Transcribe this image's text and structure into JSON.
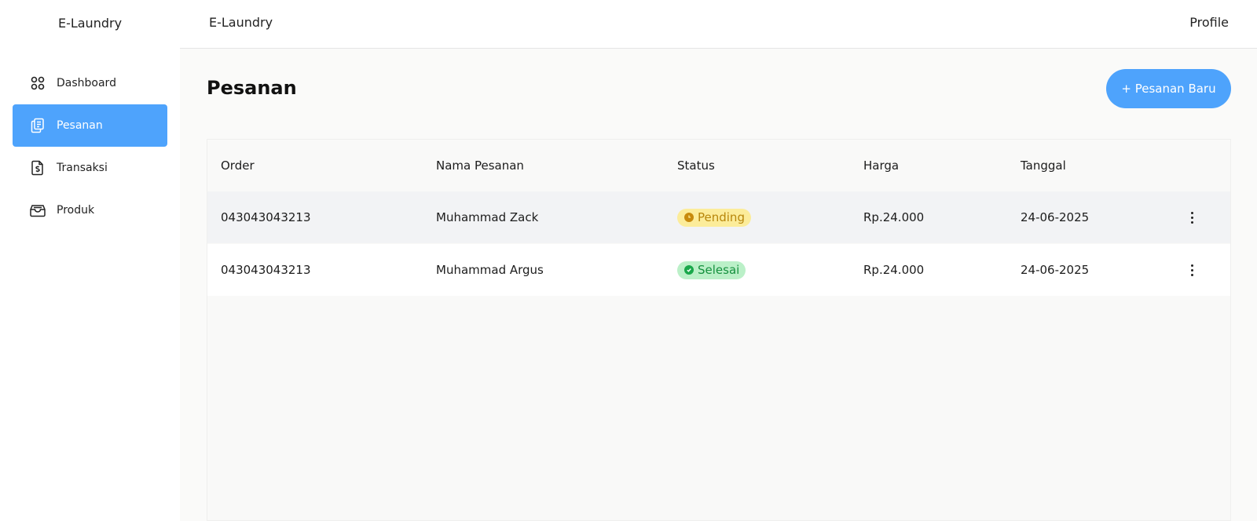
{
  "sidebar": {
    "brand": "E-Laundry",
    "items": [
      {
        "label": "Dashboard",
        "icon": "grid-icon"
      },
      {
        "label": "Pesanan",
        "icon": "clipboard-icon",
        "active": true
      },
      {
        "label": "Transaksi",
        "icon": "invoice-dollar-icon"
      },
      {
        "label": "Produk",
        "icon": "box-icon"
      }
    ]
  },
  "header": {
    "title": "E-Laundry",
    "profile": "Profile"
  },
  "main": {
    "page_title": "Pesanan",
    "new_button": "+ Pesanan Baru",
    "table": {
      "columns": [
        "Order",
        "Nama Pesanan",
        "Status",
        "Harga",
        "Tanggal"
      ],
      "rows": [
        {
          "order": "043043043213",
          "name": "Muhammad Zack",
          "status": "Pending",
          "status_type": "pending",
          "harga": "Rp.24.000",
          "tanggal": "24-06-2025"
        },
        {
          "order": "043043043213",
          "name": "Muhammad Argus",
          "status": "Selesai",
          "status_type": "done",
          "harga": "Rp.24.000",
          "tanggal": "24-06-2025"
        }
      ]
    }
  },
  "colors": {
    "accent": "#4ea3fc",
    "pending_bg": "#fcec9a",
    "pending_fg": "#b8860b",
    "done_bg": "#bbf0c8",
    "done_fg": "#16913f"
  }
}
